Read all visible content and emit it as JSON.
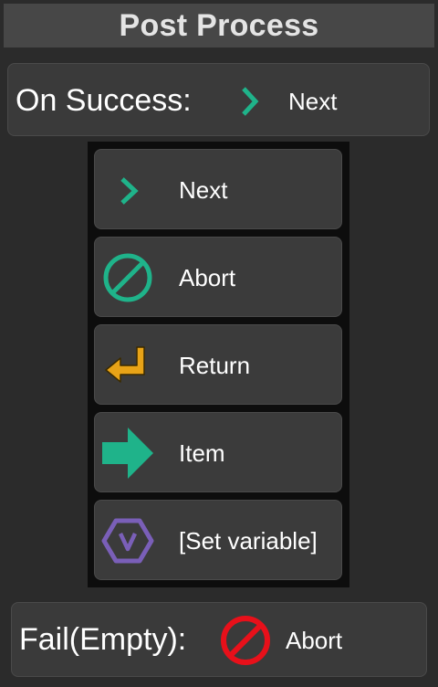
{
  "header": {
    "title": "Post Process"
  },
  "on_success": {
    "label": "On Success:",
    "value": "Next",
    "value_icon": "chevron-right-icon"
  },
  "dropdown": {
    "options": [
      {
        "label": "Next",
        "icon": "chevron-right-icon",
        "color": "#1fb38a"
      },
      {
        "label": "Abort",
        "icon": "prohibited-icon",
        "color": "#1fb38a"
      },
      {
        "label": "Return",
        "icon": "return-arrow-icon",
        "color": "#e8a317"
      },
      {
        "label": "Item",
        "icon": "arrow-right-icon",
        "color": "#1fb38a"
      },
      {
        "label": "[Set variable]",
        "icon": "variable-hexagon-icon",
        "color": "#7a5fb8"
      }
    ]
  },
  "fail": {
    "label": "Fail(Empty):",
    "value": "Abort",
    "value_icon": "prohibited-icon",
    "color": "#e8101a"
  }
}
